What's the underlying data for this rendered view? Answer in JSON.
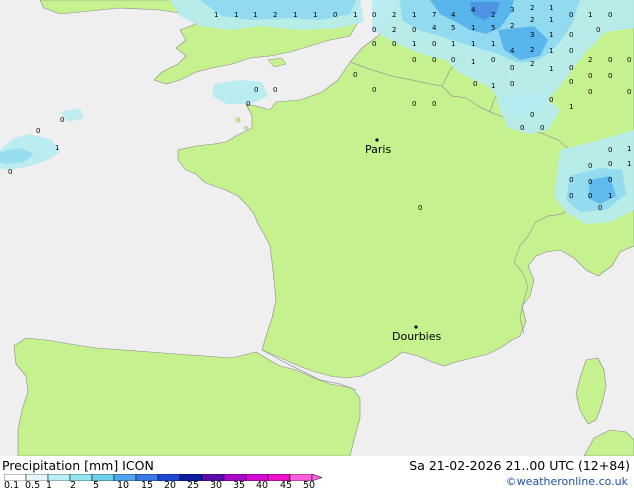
{
  "footer": {
    "title": "Precipitation [mm]  ICON",
    "datetime": "Sa 21-02-2026 21..00 UTC (12+84)",
    "credit": "©weatheronline.co.uk"
  },
  "colors": {
    "sea": "#efefef",
    "land": "#c5f28e",
    "border": "#8a8a8a",
    "precip_light": "#b5ebf2",
    "precip_mid": "#8fd9ef",
    "precip_heavy": "#56b4ec",
    "precip_dark": "#4a90e0"
  },
  "cities": [
    {
      "name": "Paris"
    },
    {
      "name": "Dourbies"
    }
  ],
  "legend": {
    "values": [
      "0.1",
      "0.5",
      "1",
      "2",
      "5",
      "10",
      "15",
      "20",
      "25",
      "30",
      "35",
      "40",
      "45",
      "50"
    ],
    "colors": [
      "#ffffff",
      "#e6f8fb",
      "#b8eef5",
      "#96e3f0",
      "#6cd0ea",
      "#50a6ee",
      "#3a78e8",
      "#1d49d2",
      "#0c1fa3",
      "#5b0ca8",
      "#a70ac9",
      "#d40ad4",
      "#ec10cc",
      "#f85fde"
    ]
  },
  "precip_labels": [
    "1",
    "1",
    "1",
    "2",
    "1",
    "1",
    "0",
    "0",
    "2",
    "7",
    "4",
    "3",
    "2",
    "1",
    "0",
    "1",
    "2",
    "0",
    "4",
    "4",
    "1",
    "0",
    "2",
    "5",
    "2",
    "1",
    "0",
    "2",
    "3",
    "1",
    "1",
    "1",
    "0",
    "0",
    "5",
    "0",
    "0",
    "4",
    "2",
    "1",
    "0",
    "1",
    "1",
    "0",
    "1",
    "1",
    "2",
    "0",
    "1",
    "0",
    "0",
    "0",
    "0",
    "0",
    "0",
    "1",
    "2",
    "0",
    "0",
    "0",
    "0",
    "0",
    "1",
    "0",
    "0",
    "0",
    "0",
    "0",
    "0",
    "1",
    "0",
    "0",
    "0",
    "1",
    "0",
    "0",
    "0",
    "0",
    "0",
    "0",
    "0",
    "0",
    "0",
    "1",
    "0",
    "0",
    "1",
    "0",
    "0",
    "0",
    "0",
    "0",
    "1",
    "0",
    "0"
  ]
}
